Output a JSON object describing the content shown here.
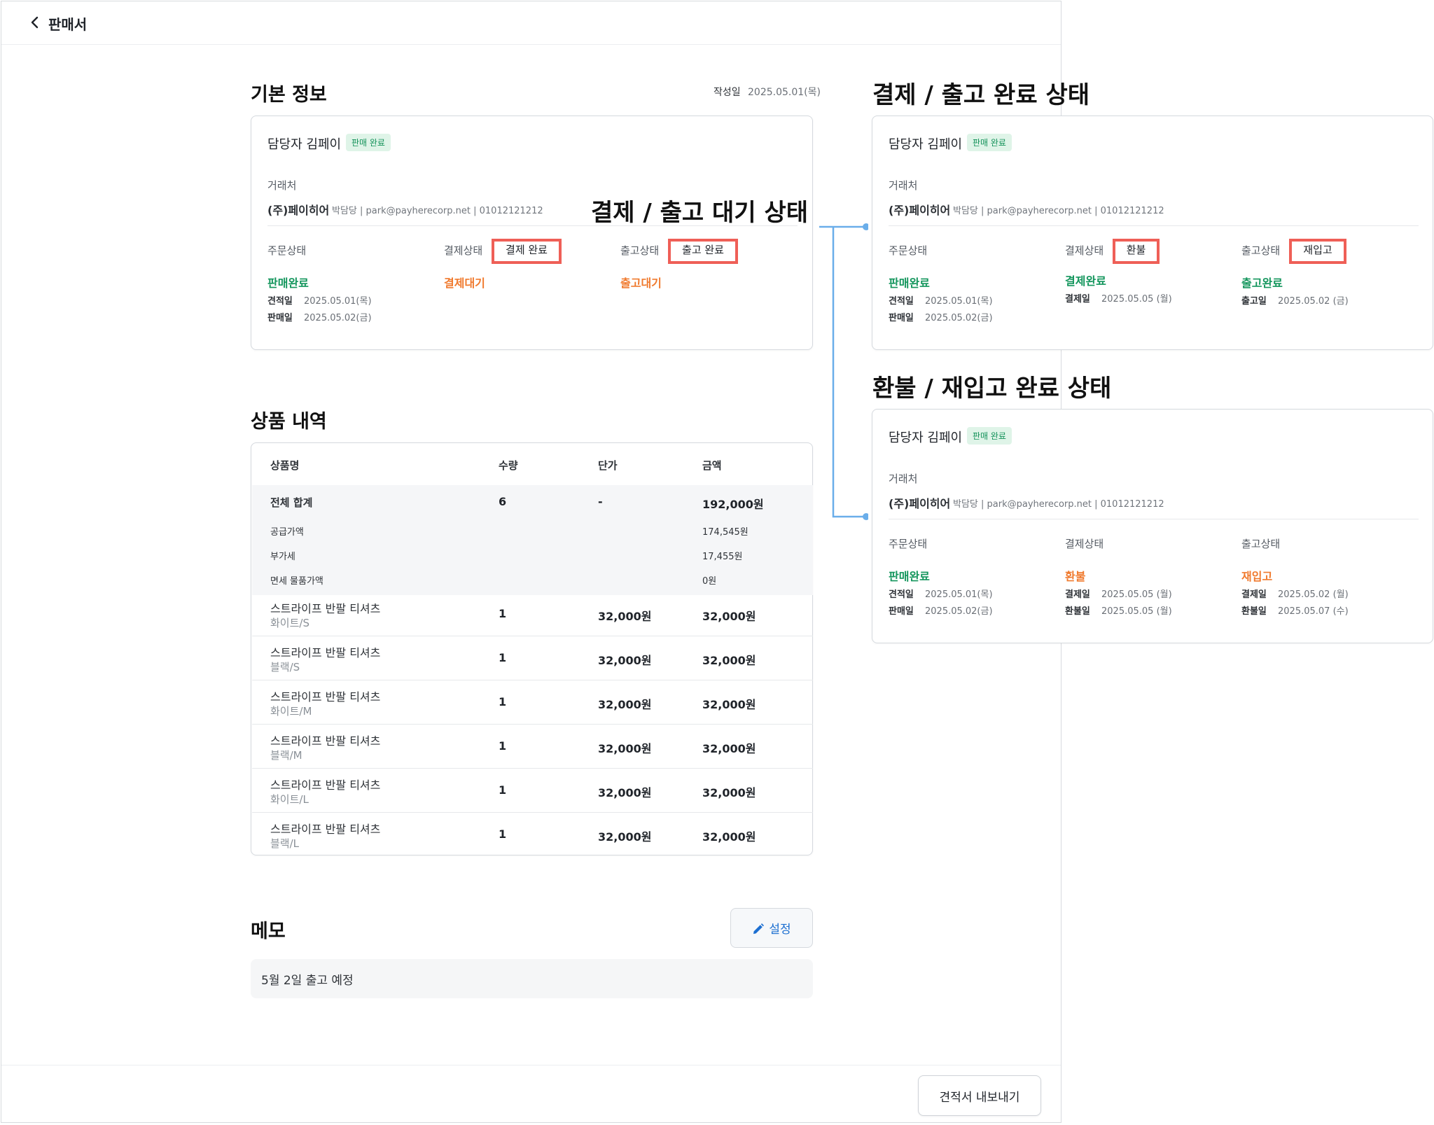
{
  "header": {
    "title": "판매서"
  },
  "footer": {
    "export_label": "견적서 내보내기"
  },
  "basic_info": {
    "title": "기본 정보",
    "created_label": "작성일",
    "created_date": "2025.05.01(목)"
  },
  "card_common": {
    "manager": "담당자 김페이",
    "badge": "판매 완료",
    "client_label": "거래처",
    "client_name": "(주)페이히어",
    "client_meta": "박담당 | park@payherecorp.net | 01012121212",
    "order_label": "주문상태",
    "payment_label": "결제상태",
    "shipping_label": "출고상태",
    "order_status": "판매완료",
    "quote_date_label": "견적일",
    "quote_date": "2025.05.01(목)",
    "sale_date_label": "판매일",
    "sale_date": "2025.05.02(금)"
  },
  "waiting_state": {
    "annotation": "결제 / 출고 대기 상태",
    "payment_box": "결제 완료",
    "shipping_box": "출고 완료",
    "payment_status": "결제대기",
    "shipping_status": "출고대기"
  },
  "completed_state": {
    "annotation": "결제 / 출고 완료 상태",
    "payment_box": "환불",
    "shipping_box": "재입고",
    "payment_status": "결제완료",
    "payment_date_label": "결제일",
    "payment_date": "2025.05.05 (월)",
    "shipping_status": "출고완료",
    "shipping_date_label": "출고일",
    "shipping_date": "2025.05.02 (금)"
  },
  "refund_state": {
    "annotation": "환불 / 재입고 완료 상태",
    "payment_status": "환불",
    "payment_date_label": "결제일",
    "payment_date": "2025.05.05 (월)",
    "refund_date_label": "환불일",
    "refund_date": "2025.05.05 (월)",
    "shipping_status": "재입고",
    "shipping_date_label": "결제일",
    "shipping_date": "2025.05.02 (월)",
    "restock_date_label": "환불일",
    "restock_date": "2025.05.07 (수)"
  },
  "products": {
    "title": "상품 내역",
    "columns": [
      "상품명",
      "수량",
      "단가",
      "금액"
    ],
    "total": {
      "label": "전체 합계",
      "qty": "6",
      "unit": "-",
      "amount": "192,000원"
    },
    "subtotals": [
      {
        "label": "공급가액",
        "amount": "174,545원"
      },
      {
        "label": "부가세",
        "amount": "17,455원"
      },
      {
        "label": "면세 물품가액",
        "amount": "0원"
      }
    ],
    "rows": [
      {
        "name": "스트라이프 반팔 티셔츠",
        "option": "화이트/S",
        "qty": "1",
        "unit": "32,000원",
        "amount": "32,000원"
      },
      {
        "name": "스트라이프 반팔 티셔츠",
        "option": "블랙/S",
        "qty": "1",
        "unit": "32,000원",
        "amount": "32,000원"
      },
      {
        "name": "스트라이프 반팔 티셔츠",
        "option": "화이트/M",
        "qty": "1",
        "unit": "32,000원",
        "amount": "32,000원"
      },
      {
        "name": "스트라이프 반팔 티셔츠",
        "option": "블랙/M",
        "qty": "1",
        "unit": "32,000원",
        "amount": "32,000원"
      },
      {
        "name": "스트라이프 반팔 티셔츠",
        "option": "화이트/L",
        "qty": "1",
        "unit": "32,000원",
        "amount": "32,000원"
      },
      {
        "name": "스트라이프 반팔 티셔츠",
        "option": "블랙/L",
        "qty": "1",
        "unit": "32,000원",
        "amount": "32,000원"
      }
    ]
  },
  "memo": {
    "title": "메모",
    "button_label": "설정",
    "text": "5월 2일 출고 예정"
  },
  "colors": {
    "green": "#14965d",
    "orange": "#f07a2e",
    "highlight": "#ef5f57",
    "connector": "#6aaeea"
  }
}
